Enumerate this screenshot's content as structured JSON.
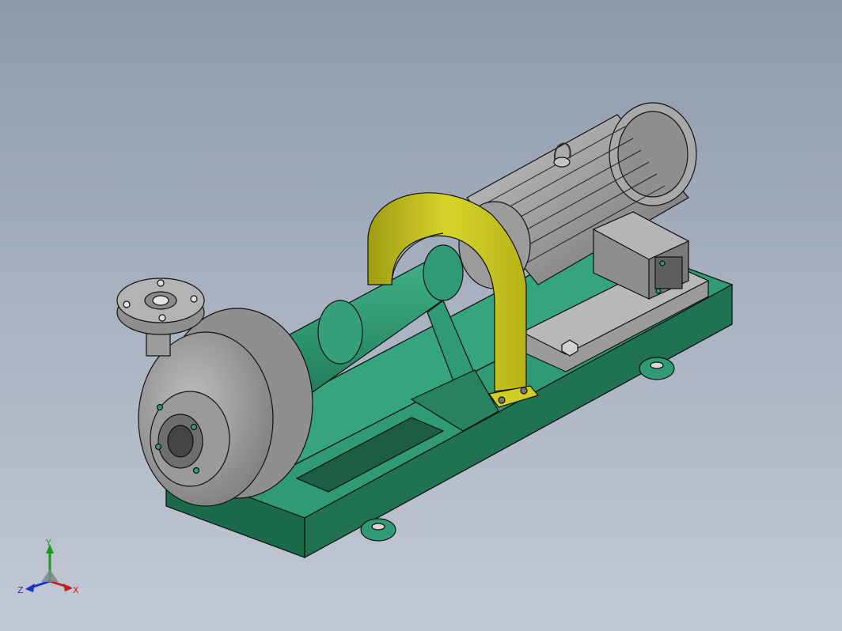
{
  "scene": {
    "background_top": "#8e9aab",
    "background_bottom": "#c3c9d4",
    "colors": {
      "base_frame": "#2f9a74",
      "pump_shaft": "#2f9a74",
      "motor_body": "#9a9a9a",
      "pump_casing": "#a2a2a2",
      "guard_strap": "#c9c81a",
      "outline": "#111111"
    }
  },
  "triad": {
    "x_label": "X",
    "y_label": "Y",
    "z_label": "Z",
    "x_color": "#c42020",
    "y_color": "#1d9a1d",
    "z_color": "#1e2fc4"
  }
}
